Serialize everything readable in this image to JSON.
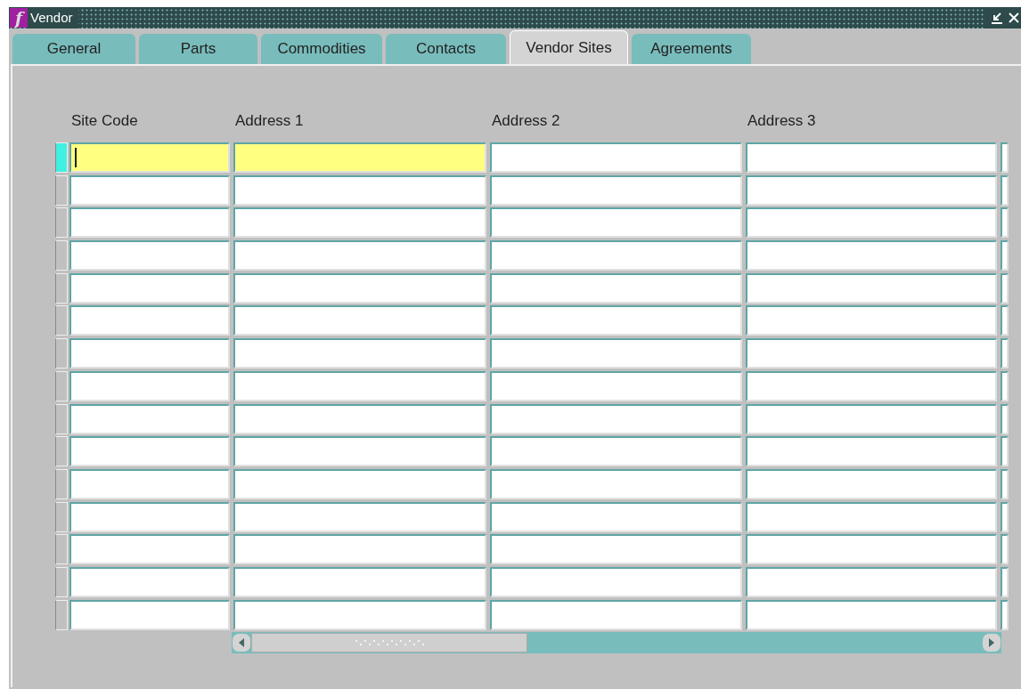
{
  "window": {
    "app_icon_letter": "f",
    "title": "Vendor"
  },
  "tabs": [
    {
      "label": "General",
      "selected": false
    },
    {
      "label": "Parts",
      "selected": false
    },
    {
      "label": "Commodities",
      "selected": false
    },
    {
      "label": "Contacts",
      "selected": false
    },
    {
      "label": "Vendor Sites",
      "selected": true
    },
    {
      "label": "Agreements",
      "selected": false
    }
  ],
  "table": {
    "columns": [
      "Site Code",
      "Address 1",
      "Address 2",
      "Address 3"
    ],
    "rows": [
      {
        "selected": true,
        "cells": [
          {
            "highlighted": true,
            "focused": true
          },
          {
            "highlighted": true,
            "focused": false
          },
          {
            "highlighted": false,
            "focused": false
          },
          {
            "highlighted": false,
            "focused": false
          }
        ]
      },
      {
        "selected": false,
        "cells": [
          {
            "highlighted": false,
            "focused": false
          },
          {
            "highlighted": false,
            "focused": false
          },
          {
            "highlighted": false,
            "focused": false
          },
          {
            "highlighted": false,
            "focused": false
          }
        ]
      },
      {
        "selected": false,
        "cells": [
          {
            "highlighted": false,
            "focused": false
          },
          {
            "highlighted": false,
            "focused": false
          },
          {
            "highlighted": false,
            "focused": false
          },
          {
            "highlighted": false,
            "focused": false
          }
        ]
      },
      {
        "selected": false,
        "cells": [
          {
            "highlighted": false,
            "focused": false
          },
          {
            "highlighted": false,
            "focused": false
          },
          {
            "highlighted": false,
            "focused": false
          },
          {
            "highlighted": false,
            "focused": false
          }
        ]
      },
      {
        "selected": false,
        "cells": [
          {
            "highlighted": false,
            "focused": false
          },
          {
            "highlighted": false,
            "focused": false
          },
          {
            "highlighted": false,
            "focused": false
          },
          {
            "highlighted": false,
            "focused": false
          }
        ]
      },
      {
        "selected": false,
        "cells": [
          {
            "highlighted": false,
            "focused": false
          },
          {
            "highlighted": false,
            "focused": false
          },
          {
            "highlighted": false,
            "focused": false
          },
          {
            "highlighted": false,
            "focused": false
          }
        ]
      },
      {
        "selected": false,
        "cells": [
          {
            "highlighted": false,
            "focused": false
          },
          {
            "highlighted": false,
            "focused": false
          },
          {
            "highlighted": false,
            "focused": false
          },
          {
            "highlighted": false,
            "focused": false
          }
        ]
      },
      {
        "selected": false,
        "cells": [
          {
            "highlighted": false,
            "focused": false
          },
          {
            "highlighted": false,
            "focused": false
          },
          {
            "highlighted": false,
            "focused": false
          },
          {
            "highlighted": false,
            "focused": false
          }
        ]
      },
      {
        "selected": false,
        "cells": [
          {
            "highlighted": false,
            "focused": false
          },
          {
            "highlighted": false,
            "focused": false
          },
          {
            "highlighted": false,
            "focused": false
          },
          {
            "highlighted": false,
            "focused": false
          }
        ]
      },
      {
        "selected": false,
        "cells": [
          {
            "highlighted": false,
            "focused": false
          },
          {
            "highlighted": false,
            "focused": false
          },
          {
            "highlighted": false,
            "focused": false
          },
          {
            "highlighted": false,
            "focused": false
          }
        ]
      },
      {
        "selected": false,
        "cells": [
          {
            "highlighted": false,
            "focused": false
          },
          {
            "highlighted": false,
            "focused": false
          },
          {
            "highlighted": false,
            "focused": false
          },
          {
            "highlighted": false,
            "focused": false
          }
        ]
      },
      {
        "selected": false,
        "cells": [
          {
            "highlighted": false,
            "focused": false
          },
          {
            "highlighted": false,
            "focused": false
          },
          {
            "highlighted": false,
            "focused": false
          },
          {
            "highlighted": false,
            "focused": false
          }
        ]
      },
      {
        "selected": false,
        "cells": [
          {
            "highlighted": false,
            "focused": false
          },
          {
            "highlighted": false,
            "focused": false
          },
          {
            "highlighted": false,
            "focused": false
          },
          {
            "highlighted": false,
            "focused": false
          }
        ]
      },
      {
        "selected": false,
        "cells": [
          {
            "highlighted": false,
            "focused": false
          },
          {
            "highlighted": false,
            "focused": false
          },
          {
            "highlighted": false,
            "focused": false
          },
          {
            "highlighted": false,
            "focused": false
          }
        ]
      },
      {
        "selected": false,
        "cells": [
          {
            "highlighted": false,
            "focused": false
          },
          {
            "highlighted": false,
            "focused": false
          },
          {
            "highlighted": false,
            "focused": false
          },
          {
            "highlighted": false,
            "focused": false
          }
        ]
      }
    ]
  }
}
